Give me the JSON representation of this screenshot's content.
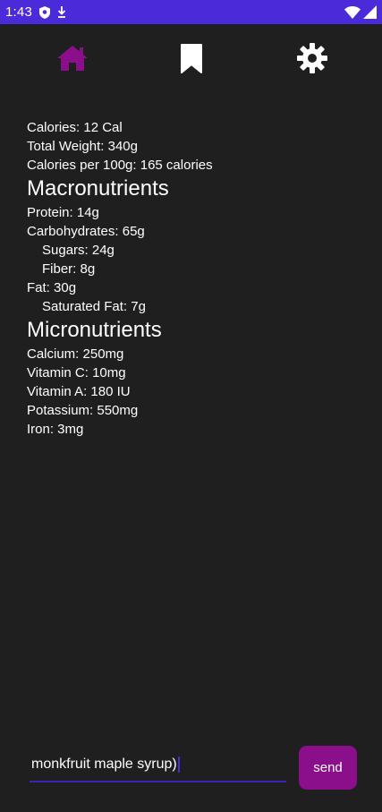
{
  "status_bar": {
    "time": "1:43",
    "bg_color": "#4b2ad9",
    "left_icons": [
      "shield-icon",
      "download-arrow-icon"
    ],
    "right_icons": [
      "wifi-icon",
      "cellular-signal-icon"
    ]
  },
  "nav": {
    "items": [
      {
        "name": "home",
        "icon": "home-icon",
        "active": true,
        "color": "#8b0f8a"
      },
      {
        "name": "bookmark",
        "icon": "bookmark-icon",
        "active": false,
        "color": "#ffffff"
      },
      {
        "name": "settings",
        "icon": "gear-icon",
        "active": false,
        "color": "#ffffff"
      }
    ]
  },
  "nutrition": {
    "calories": "Calories: 12 Cal",
    "total_weight": "Total Weight: 340g",
    "calories_per_100g": "Calories per 100g: 165 calories",
    "macros_heading": "Macronutrients",
    "protein": "Protein: 14g",
    "carbohydrates": "Carbohydrates: 65g",
    "sugars": "Sugars: 24g",
    "fiber": "Fiber: 8g",
    "fat": "Fat: 30g",
    "saturated_fat": "Saturated Fat: 7g",
    "micros_heading": "Micronutrients",
    "calcium": "Calcium: 250mg",
    "vitamin_c": "Vitamin C: 10mg",
    "vitamin_a": "Vitamin A: 180 IU",
    "potassium": "Potassium: 550mg",
    "iron": "Iron: 3mg"
  },
  "input": {
    "value": "monkfruit maple syrup)",
    "underline_color": "#3f23b8"
  },
  "send_button": {
    "label": "send",
    "bg_color": "#8b0f8a"
  }
}
